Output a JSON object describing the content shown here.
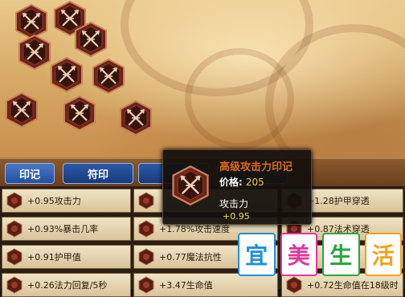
{
  "tabs": [
    {
      "label": "印记",
      "active": true
    },
    {
      "label": "符印",
      "active": false
    },
    {
      "label": "",
      "active": false
    },
    {
      "label": "",
      "active": false
    }
  ],
  "runes": [
    {
      "text": "+0.95攻击力"
    },
    {
      "text": ""
    },
    {
      "text": "+1.28护甲穿透"
    },
    {
      "text": "+0.93%暴击几率"
    },
    {
      "text": "+1.78%攻击速度"
    },
    {
      "text": "+0.87法术穿透"
    },
    {
      "text": "+0.91护甲值"
    },
    {
      "text": "+0.77魔法抗性"
    },
    {
      "text": ""
    },
    {
      "text": "+0.26法力回复/5秒"
    },
    {
      "text": "+3.47生命值"
    },
    {
      "text": "+0.72生命值在18级时"
    }
  ],
  "tooltip": {
    "title": "高级攻击力印记",
    "price_label": "价格:",
    "price_value": "205",
    "stat_label": "攻击力",
    "stat_value": "+0.95"
  },
  "watermark": {
    "chars": [
      "宜",
      "美",
      "生",
      "活"
    ],
    "colors": [
      "#1e8fe0",
      "#e0379a",
      "#2aa640",
      "#f0a31e"
    ]
  }
}
